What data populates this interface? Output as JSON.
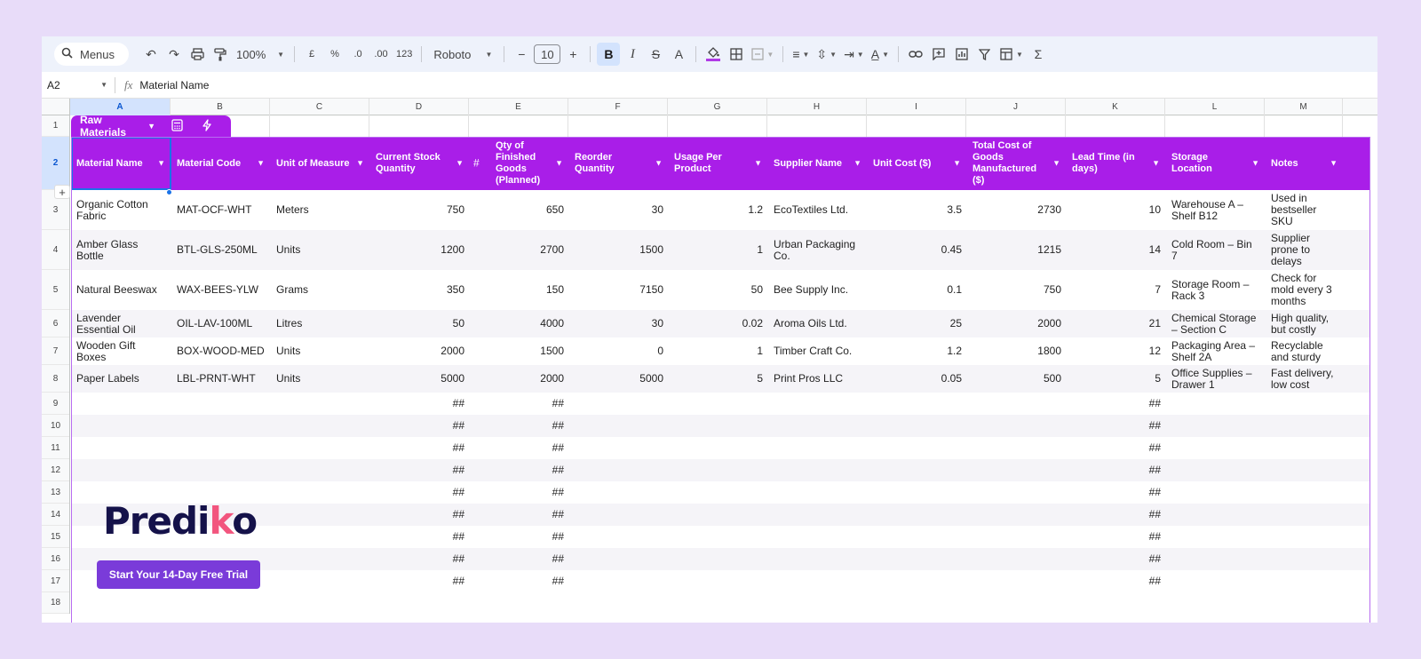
{
  "toolbar": {
    "menus_label": "Menus",
    "zoom": "100%",
    "currency": "£",
    "percent": "%",
    "dec_decrease": ".0",
    "dec_increase": ".00",
    "number_format": "123",
    "font": "Roboto",
    "minus": "−",
    "font_size": "10",
    "plus": "+",
    "bold": "B",
    "italic": "I",
    "strike": "S",
    "text_color": "A",
    "sum": "Σ"
  },
  "formula_bar": {
    "cell_ref": "A2",
    "fx": "fx",
    "content": "Material Name"
  },
  "columns": [
    "A",
    "B",
    "C",
    "D",
    "E",
    "F",
    "G",
    "H",
    "I",
    "J",
    "K",
    "L",
    "M"
  ],
  "rows": [
    "1",
    "2",
    "3",
    "4",
    "5",
    "6",
    "7",
    "8",
    "9",
    "10",
    "11",
    "12",
    "13",
    "14",
    "15",
    "16",
    "17",
    "18"
  ],
  "table": {
    "name": "Raw Materials",
    "headers": [
      "Material Name",
      "Material Code",
      "Unit of Measure",
      "Current Stock Quantity",
      "Qty of Finished Goods (Planned)",
      "Reorder Quantity",
      "Usage Per Product",
      "Supplier Name",
      "Unit Cost ($)",
      "Total Cost of Goods Manufactured ($)",
      "Lead Time (in days)",
      "Storage Location",
      "Notes"
    ],
    "hash_symbol": "#",
    "rows": [
      [
        "Organic Cotton Fabric",
        "MAT-OCF-WHT",
        "Meters",
        "750",
        "650",
        "30",
        "1.2",
        "EcoTextiles Ltd.",
        "3.5",
        "2730",
        "10",
        "Warehouse A – Shelf B12",
        "Used in bestseller SKU"
      ],
      [
        "Amber Glass Bottle",
        "BTL-GLS-250ML",
        "Units",
        "1200",
        "2700",
        "1500",
        "1",
        "Urban Packaging Co.",
        "0.45",
        "1215",
        "14",
        "Cold Room – Bin 7",
        "Supplier prone to delays"
      ],
      [
        "Natural Beeswax",
        "WAX-BEES-YLW",
        "Grams",
        "350",
        "150",
        "7150",
        "50",
        "Bee Supply Inc.",
        "0.1",
        "750",
        "7",
        "Storage Room – Rack 3",
        "Check for mold every 3 months"
      ],
      [
        "Lavender Essential Oil",
        "OIL-LAV-100ML",
        "Litres",
        "50",
        "4000",
        "30",
        "0.02",
        "Aroma Oils Ltd.",
        "25",
        "2000",
        "21",
        "Chemical Storage – Section C",
        "High quality, but costly"
      ],
      [
        "Wooden Gift Boxes",
        "BOX-WOOD-MED",
        "Units",
        "2000",
        "1500",
        "0",
        "1",
        "Timber Craft Co.",
        "1.2",
        "1800",
        "12",
        "Packaging Area – Shelf 2A",
        "Recyclable and sturdy"
      ],
      [
        "Paper Labels",
        "LBL-PRNT-WHT",
        "Units",
        "5000",
        "2000",
        "5000",
        "5",
        "Print Pros LLC",
        "0.05",
        "500",
        "5",
        "Office Supplies – Drawer 1",
        "Fast delivery, low cost"
      ]
    ],
    "overflow": "##"
  },
  "branding": {
    "logo_a": "Predi",
    "logo_k": "k",
    "logo_b": "o",
    "cta": "Start Your 14-Day Free Trial"
  },
  "colors": {
    "page_bg": "#e8dcf9",
    "table_purple": "#a91ee8",
    "selection_blue": "#1a73e8",
    "cta_purple": "#7a3bd9",
    "logo_navy": "#15124a",
    "logo_pink": "#f2557e"
  }
}
